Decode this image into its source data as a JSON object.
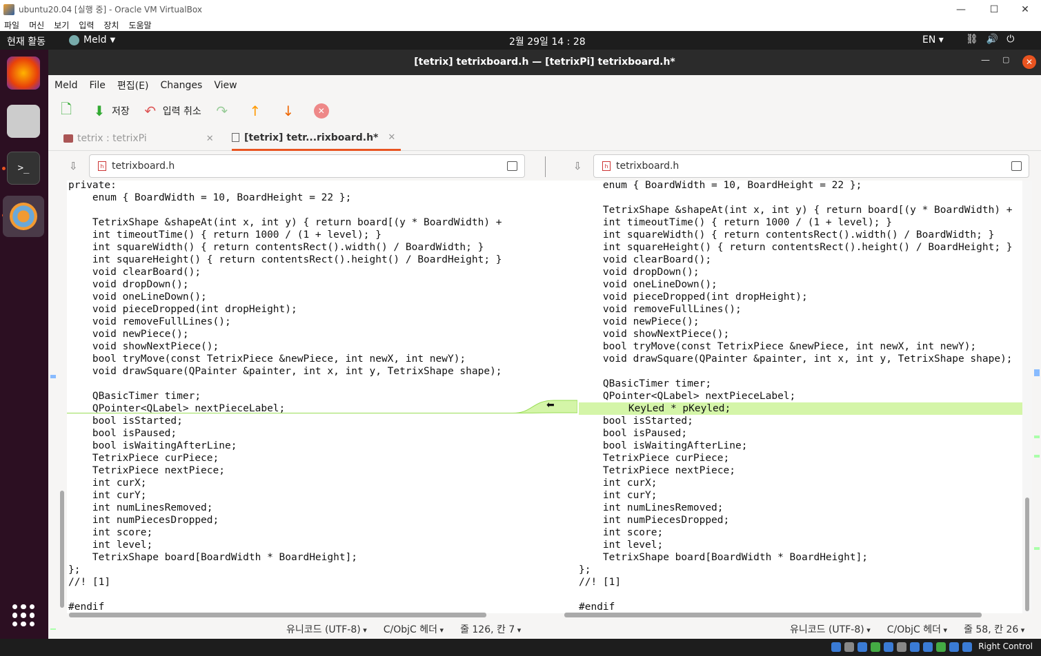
{
  "vbox": {
    "title": "ubuntu20.04 [실행 중] - Oracle VM VirtualBox",
    "menu": [
      "파일",
      "머신",
      "보기",
      "입력",
      "장치",
      "도움말"
    ],
    "right_control": "Right Control"
  },
  "topbar": {
    "activities": "현재 활동",
    "app": "Meld",
    "clock": "2월 29일  14 : 28",
    "lang": "EN"
  },
  "window": {
    "title": "[tetrix] tetrixboard.h — [tetrixPi] tetrixboard.h*"
  },
  "menubar": [
    "Meld",
    "File",
    "편집(E)",
    "Changes",
    "View"
  ],
  "toolbar": {
    "save": "저장",
    "undo": "입력 취소"
  },
  "tabs": [
    {
      "label": "tetrix : tetrixPi"
    },
    {
      "label": "[tetrix] tetr...rixboard.h*"
    }
  ],
  "files": {
    "left": "tetrixboard.h",
    "right": "tetrixboard.h"
  },
  "left_lines": [
    "private:",
    "    enum { BoardWidth = 10, BoardHeight = 22 };",
    "",
    "    TetrixShape &shapeAt(int x, int y) { return board[(y * BoardWidth) +",
    "    int timeoutTime() { return 1000 / (1 + level); }",
    "    int squareWidth() { return contentsRect().width() / BoardWidth; }",
    "    int squareHeight() { return contentsRect().height() / BoardHeight; }",
    "    void clearBoard();",
    "    void dropDown();",
    "    void oneLineDown();",
    "    void pieceDropped(int dropHeight);",
    "    void removeFullLines();",
    "    void newPiece();",
    "    void showNextPiece();",
    "    bool tryMove(const TetrixPiece &newPiece, int newX, int newY);",
    "    void drawSquare(QPainter &painter, int x, int y, TetrixShape shape);",
    "",
    "    QBasicTimer timer;",
    "    QPointer<QLabel> nextPieceLabel;",
    "    bool isStarted;",
    "    bool isPaused;",
    "    bool isWaitingAfterLine;",
    "    TetrixPiece curPiece;",
    "    TetrixPiece nextPiece;",
    "    int curX;",
    "    int curY;",
    "    int numLinesRemoved;",
    "    int numPiecesDropped;",
    "    int score;",
    "    int level;",
    "    TetrixShape board[BoardWidth * BoardHeight];",
    "};",
    "//! [1]",
    "",
    "#endif"
  ],
  "right_lines": [
    "    enum { BoardWidth = 10, BoardHeight = 22 };",
    "",
    "    TetrixShape &shapeAt(int x, int y) { return board[(y * BoardWidth) +",
    "    int timeoutTime() { return 1000 / (1 + level); }",
    "    int squareWidth() { return contentsRect().width() / BoardWidth; }",
    "    int squareHeight() { return contentsRect().height() / BoardHeight; }",
    "    void clearBoard();",
    "    void dropDown();",
    "    void oneLineDown();",
    "    void pieceDropped(int dropHeight);",
    "    void removeFullLines();",
    "    void newPiece();",
    "    void showNextPiece();",
    "    bool tryMove(const TetrixPiece &newPiece, int newX, int newY);",
    "    void drawSquare(QPainter &painter, int x, int y, TetrixShape shape);",
    "",
    "    QBasicTimer timer;",
    "    QPointer<QLabel> nextPieceLabel;",
    "        KeyLed * pKeyled;",
    "    bool isStarted;",
    "    bool isPaused;",
    "    bool isWaitingAfterLine;",
    "    TetrixPiece curPiece;",
    "    TetrixPiece nextPiece;",
    "    int curX;",
    "    int curY;",
    "    int numLinesRemoved;",
    "    int numPiecesDropped;",
    "    int score;",
    "    int level;",
    "    TetrixShape board[BoardWidth * BoardHeight];",
    "};",
    "//! [1]",
    "",
    "#endif"
  ],
  "right_inserted_line": 18,
  "status_left": {
    "encoding": "유니코드 (UTF-8)",
    "lang": "C/ObjC 헤더",
    "pos": "줄 126, 칸 7"
  },
  "status_right": {
    "encoding": "유니코드 (UTF-8)",
    "lang": "C/ObjC 헤더",
    "pos": "줄 58, 칸 26"
  },
  "colors": {
    "insert": "#d4f5a8",
    "accent": "#e95420"
  }
}
